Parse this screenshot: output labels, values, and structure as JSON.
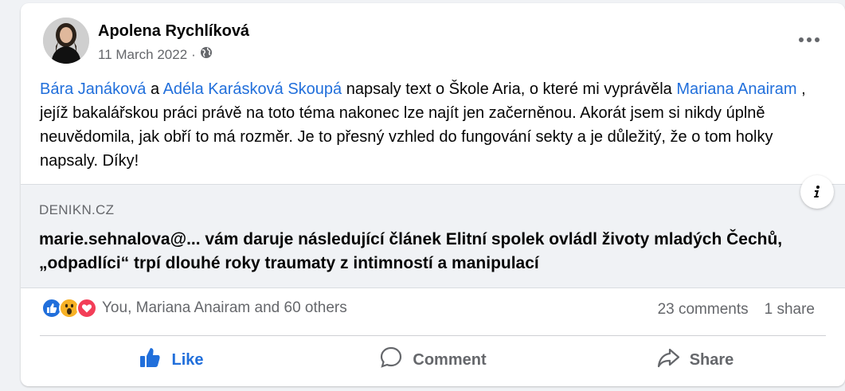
{
  "post": {
    "author": "Apolena Rychlíková",
    "date": "11 March 2022",
    "separator": "·",
    "audience_icon": "globe-icon",
    "more_icon": "more-horizontal-icon",
    "text": {
      "mention_1": "Bára Janáková",
      "conj": " a ",
      "mention_2": "Adéla Karásková Skoupá",
      "part_1": " napsaly text o Škole Aria, o které mi vyprávěla ",
      "mention_3": "Mariana Anairam",
      "part_2": " , jejíž bakalářskou práci právě na toto téma nakonec lze najít jen začerněnou. Akorát jsem si nikdy úplně neuvědomila, jak obří to má rozměr. Je to přesný vzhled do fungování sekty a je důležitý, že o tom holky napsaly. Díky!"
    }
  },
  "link_preview": {
    "domain": "DENIKN.CZ",
    "headline": "marie.sehnalova@... vám daruje následující článek Elitní spolek ovládl životy mladých Čechů, „odpadlíci“ trpí dlouhé roky traumaty z intimností a manipulací",
    "info_icon": "info-icon"
  },
  "engagement": {
    "reaction_icons": [
      "like-reaction-icon",
      "wow-reaction-icon",
      "love-reaction-icon"
    ],
    "reactions_text": "You, Mariana Anairam and 60 others",
    "comments": "23 comments",
    "shares": "1 share"
  },
  "actions": {
    "like": "Like",
    "comment": "Comment",
    "share": "Share"
  },
  "colors": {
    "link": "#216fdb",
    "secondary_text": "#65676b",
    "background": "#f0f2f5",
    "like_blue": "#216fdb",
    "love_red": "#f33e58",
    "wow_yellow": "#f7b125"
  }
}
